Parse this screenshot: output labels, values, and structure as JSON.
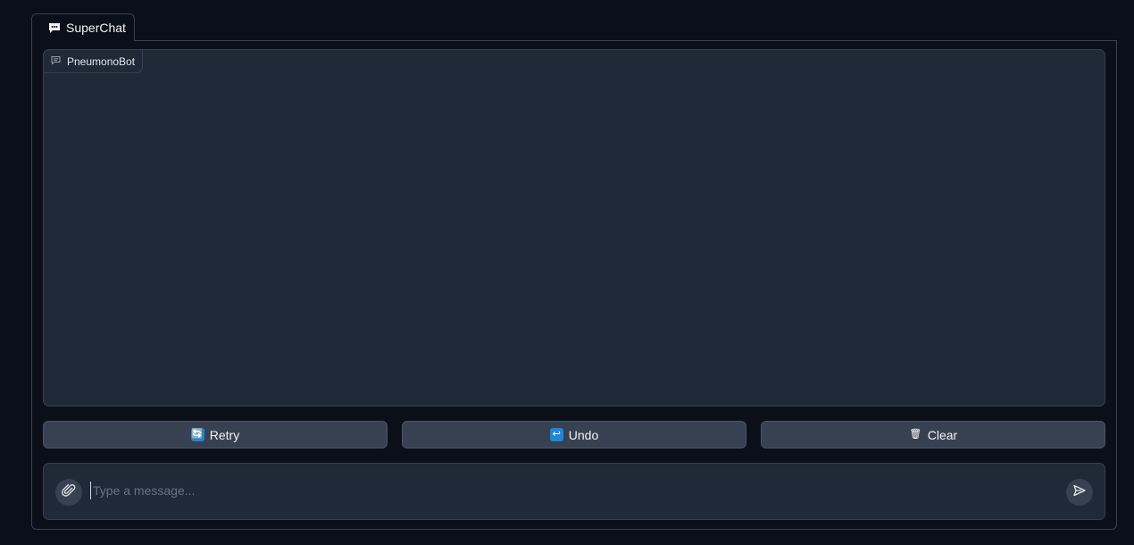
{
  "tabs": [
    {
      "label": "SuperChat",
      "icon": "speech-bubble-icon",
      "active": true
    }
  ],
  "chatbot": {
    "label": "PneumonoBot",
    "icon": "chat-icon",
    "messages": []
  },
  "actions": {
    "retry": {
      "emoji": "🔄",
      "label": "Retry"
    },
    "undo": {
      "emoji": "↩",
      "label": "Undo"
    },
    "clear": {
      "emoji": "🗑",
      "label": "Clear"
    }
  },
  "composer": {
    "placeholder": "Type a message...",
    "value": "",
    "attach_icon": "paperclip-icon",
    "send_icon": "send-icon"
  },
  "colors": {
    "background": "#0b0f19",
    "panel": "#1f2937",
    "border": "#374151",
    "button": "#374151",
    "emoji_blue": "#1f86d9"
  }
}
